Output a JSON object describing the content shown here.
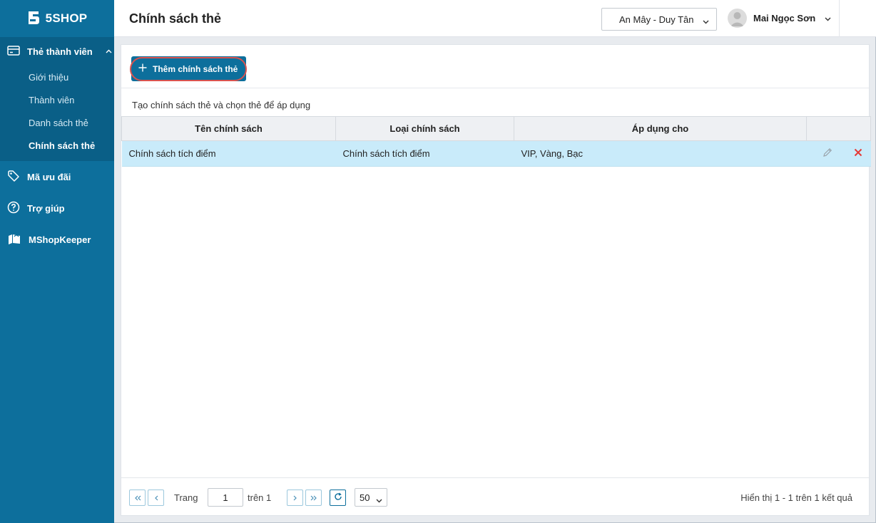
{
  "app": {
    "logo_text": "5SHOP"
  },
  "header": {
    "title": "Chính sách thẻ",
    "store": "An Mây - Duy Tân",
    "user_name": "Mai Ngọc Sơn"
  },
  "sidebar": {
    "group": {
      "label": "Thẻ thành viên",
      "items": [
        {
          "label": "Giới thiệu"
        },
        {
          "label": "Thành viên"
        },
        {
          "label": "Danh sách thẻ"
        },
        {
          "label": "Chính sách thẻ"
        }
      ]
    },
    "items": [
      {
        "label": "Mã ưu đãi"
      },
      {
        "label": "Trợ giúp"
      },
      {
        "label": "MShopKeeper"
      }
    ]
  },
  "toolbar": {
    "add_label": "Thêm chính sách thẻ"
  },
  "description": "Tạo chính sách thẻ và chọn thẻ để áp dụng",
  "table": {
    "columns": [
      "Tên chính sách",
      "Loại chính sách",
      "Áp dụng cho"
    ],
    "rows": [
      {
        "name": "Chính sách tích điểm",
        "type": "Chính sách tích điểm",
        "applies": "VIP, Vàng, Bạc"
      }
    ]
  },
  "pager": {
    "page_label": "Trang",
    "page_value": "1",
    "of_label": "trên 1",
    "page_size": "50",
    "result_text": "Hiển thị 1 - 1 trên 1 kết quả"
  },
  "colors": {
    "primary": "#0d6f9c",
    "selected_row": "#c9ebfa",
    "delete": "#e53935",
    "highlight": "#d9534f"
  }
}
